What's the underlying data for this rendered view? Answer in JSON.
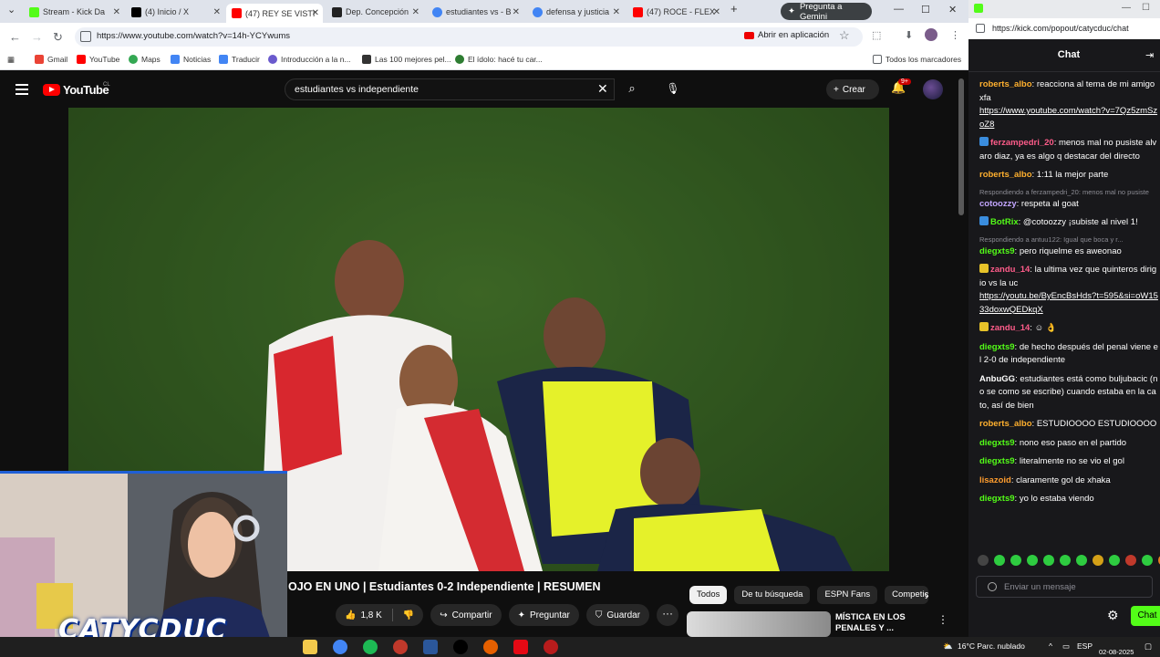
{
  "tabs": [
    {
      "label": "Stream - Kick Da",
      "color": "#53fc18"
    },
    {
      "label": "(4) Inicio / X",
      "color": "#000000"
    },
    {
      "label": "(47) REY SE VISTI",
      "color": "#ff0000",
      "active": true
    },
    {
      "label": "Dep. Concepción",
      "color": "#222222"
    },
    {
      "label": "estudiantes vs - B",
      "color": "#4285f4"
    },
    {
      "label": "defensa y justicia",
      "color": "#4285f4"
    },
    {
      "label": "(47) ROCE - FLEX",
      "color": "#ff0000"
    }
  ],
  "new_tab": "+",
  "gemini_label": "Pregunta a Gemini",
  "address": {
    "url": "https://www.youtube.com/watch?v=14h-YCYwums",
    "open_in_app": "Abrir en aplicación"
  },
  "bookmarks": [
    {
      "label": "Gmail",
      "color": "#ea4335"
    },
    {
      "label": "YouTube",
      "color": "#ff0000"
    },
    {
      "label": "Maps",
      "color": "#34a853"
    },
    {
      "label": "Noticias",
      "color": "#4285f4"
    },
    {
      "label": "Traducir",
      "color": "#4285f4"
    },
    {
      "label": "Introducción a la n...",
      "color": "#6a5acd"
    },
    {
      "label": "Las 100 mejores pel...",
      "color": "#333333"
    },
    {
      "label": "El ídolo: hacé tu car...",
      "color": "#2e7d32"
    }
  ],
  "all_bookmarks": "Todos los marcadores",
  "youtube": {
    "logo": "YouTube",
    "country": "CL",
    "search_query": "estudiantes vs independiente",
    "create_label": "Crear",
    "notif_badge": "9+",
    "video_title": "OJO EN UNO | Estudiantes 0-2 Independiente | RESUMEN",
    "likes": "1,8 K",
    "share": "Compartir",
    "ask": "Preguntar",
    "save": "Guardar",
    "chips": [
      "Todos",
      "De tu búsqueda",
      "ESPN Fans",
      "Competic"
    ],
    "recommended_title": "MÍSTICA EN LOS PENALES Y ..."
  },
  "webcam": {
    "streamer_name": "CATYCDUC"
  },
  "kick": {
    "url": "https://kick.com/popout/catycduc/chat",
    "title": "Chat",
    "input_placeholder": "Enviar un mensaje",
    "send_label": "Chat",
    "messages": [
      {
        "user": "roberts_albo",
        "color": "#ffb02e",
        "text": "reacciona al tema de mi amigo xfa",
        "link": "https://www.youtube.com/watch?v=7Qz5zmSzoZ8"
      },
      {
        "user": "ferzampedri_20",
        "color": "#ff5c8a",
        "text": "menos mal no pusiste alvaro diaz, ya es algo q destacar del directo",
        "badge": "#3a8dde"
      },
      {
        "user": "roberts_albo",
        "color": "#ffb02e",
        "text": "1:11 la mejor parte"
      },
      {
        "reply": "Respondiendo a ferzampedri_20: menos mal no pusiste",
        "user": "cotoozzy",
        "color": "#c3a6ff",
        "text": "respeta al goat"
      },
      {
        "user": "BotRix",
        "color": "#53fc18",
        "text": "@cotoozzy ¡subiste al nivel 1!",
        "badge": "#3a8dde"
      },
      {
        "reply": "Respondiendo a antuu122: Igual que boca y r...",
        "user": "diegxts9",
        "color": "#53fc18",
        "text": "pero riquelme es aweonao"
      },
      {
        "user": "zandu_14",
        "color": "#ff5c8a",
        "text": "la ultima vez que quinteros dirigio vs la uc",
        "link": "https://youtu.be/ByEncBsHds?t=595&si=oW1533doxwQEDkqX",
        "badge": "#e6c229"
      },
      {
        "user": "zandu_14",
        "color": "#ff5c8a",
        "text": "☺ 👌",
        "badge": "#e6c229"
      },
      {
        "user": "diegxts9",
        "color": "#53fc18",
        "text": "de hecho después del penal viene el 2-0 de independiente"
      },
      {
        "user": "AnbuGG",
        "color": "#ffffff",
        "text": "estudiantes está como buljubacic (no se como se escribe) cuando estaba en la cato, así de bien"
      },
      {
        "user": "roberts_albo",
        "color": "#ffb02e",
        "text": "ESTUDIOOOO ESTUDIOOOO"
      },
      {
        "user": "diegxts9",
        "color": "#53fc18",
        "text": "nono eso paso en el partido"
      },
      {
        "user": "diegxts9",
        "color": "#53fc18",
        "text": "literalmente no se vio el gol"
      },
      {
        "user": "lisazoid",
        "color": "#ff9d2e",
        "text": "claramente gol de xhaka"
      },
      {
        "user": "diegxts9",
        "color": "#53fc18",
        "text": "yo lo estaba viendo"
      }
    ]
  },
  "taskbar": {
    "weather": "16°C  Parc. nublado",
    "lang": "ESP",
    "date": "02-08-2025"
  }
}
